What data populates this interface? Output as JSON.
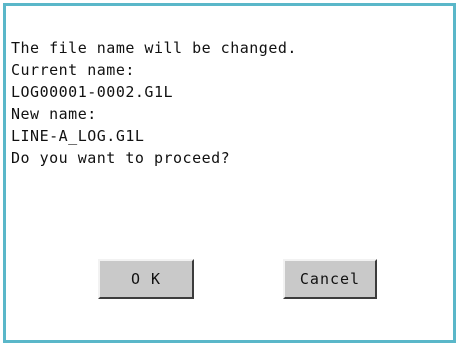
{
  "dialog": {
    "message_lines": [
      "The file name will be changed.",
      "Current name:",
      "LOG00001-0002.G1L",
      "New name:",
      "LINE-A_LOG.G1L",
      "Do you want to proceed?"
    ],
    "ok_label": "O K",
    "cancel_label": "Cancel"
  },
  "colors": {
    "frame_border": "#5ab7c9",
    "button_face": "#c9c9c9",
    "text": "#111111"
  }
}
